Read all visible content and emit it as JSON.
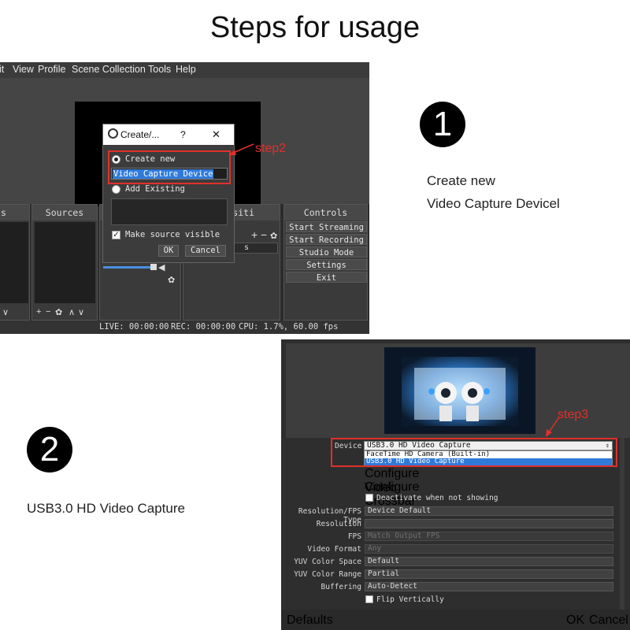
{
  "title": "Steps for usage",
  "colors": {
    "annotation_red": "#e0302a",
    "selection_blue": "#2f7ad9",
    "dark_bg": "#2b2b2b"
  },
  "shot1": {
    "menu": [
      "it",
      "View",
      "Profile",
      "Scene Collection",
      "Tools",
      "Help"
    ],
    "docks": {
      "scenes_partial": "s",
      "sources": "Sources",
      "transitions_partial": "siti",
      "controls": "Controls"
    },
    "controls": [
      "Start Streaming",
      "Start Recording",
      "Studio Mode",
      "Settings",
      "Exit"
    ],
    "transition_partial": "s",
    "toolbar": {
      "add": "+",
      "remove": "−",
      "gear": "✿",
      "up": "∧",
      "down": "∨"
    },
    "status": {
      "live": "LIVE: 00:00:00",
      "rec": "REC: 00:00:00",
      "cpu": "CPU: 1.7%, 60.00 fps"
    },
    "dialog": {
      "title": "Create/...",
      "help": "?",
      "close": "✕",
      "create_new": "Create new",
      "name_value": "Video Capture Device",
      "add_existing": "Add Existing",
      "make_visible": "Make source visible",
      "ok": "OK",
      "cancel": "Cancel"
    },
    "step_label": "step2"
  },
  "steps": [
    {
      "number": "1",
      "lines": [
        "Create new",
        "Video Capture Devicel"
      ]
    },
    {
      "number": "2",
      "lines": [
        "USB3.0 HD Video Capture"
      ]
    }
  ],
  "shot2": {
    "step_label": "step3",
    "device_label": "Device",
    "device_value": "USB3.0 HD Video Capture",
    "device_options": [
      "FaceTime HD Camera (Built-in)",
      "USB3.0 HD Video Capture"
    ],
    "configure_video": "Configure Video",
    "configure_crossbar": "Configure Crossbar",
    "deactivate": "Deactivate when not showing",
    "props": [
      {
        "label": "Resolution/FPS Type",
        "value": "Device Default",
        "dim": false
      },
      {
        "label": "Resolution",
        "value": "",
        "dim": false
      },
      {
        "label": "FPS",
        "value": "Match Output FPS",
        "dim": true
      },
      {
        "label": "Video Format",
        "value": "Any",
        "dim": true
      },
      {
        "label": "YUV Color Space",
        "value": "Default",
        "dim": false
      },
      {
        "label": "YUV Color Range",
        "value": "Partial",
        "dim": false
      },
      {
        "label": "Buffering",
        "value": "Auto-Detect",
        "dim": false
      }
    ],
    "flip": "Flip Vertically",
    "defaults": "Defaults",
    "ok": "OK",
    "cancel": "Cancel"
  }
}
